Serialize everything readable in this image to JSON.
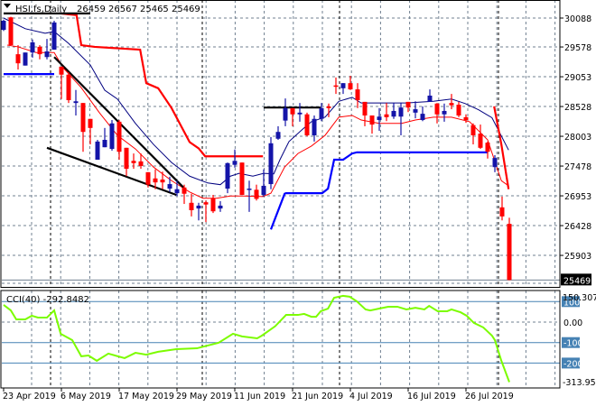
{
  "chart_data": {
    "type": "candlestick",
    "header": {
      "symbol": "HSI.fs,Daily",
      "ohlc": "26459 26567 25465 25469"
    },
    "colors": {
      "up": "#1414a8",
      "down": "#ff0000",
      "ma_fast": "#ff0000",
      "ma_slow": "#000080",
      "envelope_upper": "#ff0000",
      "envelope_lower": "#0000ff",
      "trendline": "#000000",
      "cci": "#7cfc00",
      "cci_level": "#4682b4",
      "grid": "#708090"
    },
    "price_axis": {
      "min": 25375,
      "max": 30168,
      "ticks": [
        "30088",
        "29578",
        "29053",
        "28528",
        "28003",
        "27478",
        "26953",
        "26428",
        "25903"
      ],
      "tick_values": [
        30088,
        29578,
        29053,
        28528,
        28003,
        27478,
        26953,
        26428,
        25903
      ],
      "last_price": "25469"
    },
    "date_labels": [
      {
        "bar": 0,
        "label": "23 Apr 2019"
      },
      {
        "bar": 8,
        "label": "6 May 2019"
      },
      {
        "bar": 16,
        "label": "17 May 2019"
      },
      {
        "bar": 24,
        "label": "29 May 2019"
      },
      {
        "bar": 32,
        "label": "11 Jun 2019"
      },
      {
        "bar": 40,
        "label": "21 Jun 2019"
      },
      {
        "bar": 48,
        "label": "4 Jul 2019"
      },
      {
        "bar": 56,
        "label": "16 Jul 2019"
      },
      {
        "bar": 64,
        "label": "26 Jul 2019"
      }
    ],
    "period_separators": [
      6,
      27,
      46,
      68
    ],
    "candles_ohlc": [
      [
        29880,
        30060,
        29860,
        30040
      ],
      [
        30100,
        30110,
        29610,
        29610
      ],
      [
        29450,
        29610,
        29180,
        29290
      ],
      [
        29250,
        29480,
        29250,
        29480
      ],
      [
        29480,
        29710,
        29390,
        29660
      ],
      [
        29580,
        29610,
        29360,
        29450
      ],
      [
        29400,
        29720,
        29360,
        29500
      ],
      [
        29530,
        30040,
        29530,
        30010
      ],
      [
        29230,
        29230,
        28660,
        29090
      ],
      [
        29090,
        29130,
        28590,
        28640
      ],
      [
        28590,
        28820,
        28370,
        28620
      ],
      [
        28590,
        28590,
        27730,
        28080
      ],
      [
        28310,
        28310,
        27860,
        28150
      ],
      [
        27590,
        27940,
        27590,
        27910
      ],
      [
        27810,
        28150,
        27810,
        27940
      ],
      [
        27780,
        28290,
        27750,
        28230
      ],
      [
        28260,
        28290,
        27590,
        27730
      ],
      [
        27800,
        27800,
        27300,
        27430
      ],
      [
        27570,
        27700,
        27430,
        27530
      ],
      [
        27560,
        27700,
        27430,
        27480
      ],
      [
        27370,
        27370,
        27100,
        27150
      ],
      [
        27260,
        27420,
        27070,
        27190
      ],
      [
        27240,
        27380,
        27070,
        27190
      ],
      [
        27080,
        27290,
        27020,
        27160
      ],
      [
        27000,
        27220,
        26950,
        27070
      ],
      [
        27100,
        27150,
        26810,
        26990
      ],
      [
        26830,
        26990,
        26590,
        26700
      ],
      [
        26730,
        26830,
        26520,
        26780
      ],
      [
        26840,
        26870,
        26490,
        26800
      ],
      [
        26910,
        26970,
        26650,
        26680
      ],
      [
        26730,
        26860,
        26670,
        26780
      ],
      [
        27080,
        27540,
        27000,
        27530
      ],
      [
        27500,
        27770,
        27450,
        27570
      ],
      [
        27540,
        27540,
        26970,
        26970
      ],
      [
        27070,
        27220,
        26670,
        27080
      ],
      [
        27060,
        27150,
        26870,
        26900
      ],
      [
        26970,
        27420,
        26940,
        27130
      ],
      [
        27160,
        27990,
        27070,
        27880
      ],
      [
        27960,
        28180,
        27940,
        28080
      ],
      [
        28280,
        28670,
        28180,
        28500
      ],
      [
        28500,
        28500,
        28180,
        28390
      ],
      [
        28390,
        28590,
        28260,
        28420
      ],
      [
        28390,
        28420,
        28000,
        28020
      ],
      [
        28020,
        28370,
        27910,
        28310
      ],
      [
        28310,
        28590,
        28270,
        28500
      ],
      [
        28530,
        28580,
        28340,
        28500
      ],
      [
        28900,
        29040,
        28750,
        28880
      ],
      [
        28850,
        28940,
        28750,
        28940
      ],
      [
        28940,
        29070,
        28820,
        28830
      ],
      [
        28830,
        28940,
        28500,
        28640
      ],
      [
        28610,
        28610,
        28180,
        28370
      ],
      [
        28370,
        28370,
        28050,
        28210
      ],
      [
        28290,
        28500,
        28100,
        28350
      ],
      [
        28390,
        28590,
        28270,
        28340
      ],
      [
        28350,
        28590,
        28310,
        28450
      ],
      [
        28350,
        28590,
        28020,
        28510
      ],
      [
        28610,
        28610,
        28430,
        28510
      ],
      [
        28420,
        28620,
        28320,
        28480
      ],
      [
        28290,
        28530,
        28270,
        28400
      ],
      [
        28610,
        28830,
        28610,
        28720
      ],
      [
        28580,
        28590,
        28230,
        28390
      ],
      [
        28390,
        28580,
        28260,
        28450
      ],
      [
        28590,
        28750,
        28480,
        28550
      ],
      [
        28560,
        28610,
        28340,
        28370
      ],
      [
        28340,
        28390,
        28240,
        28290
      ],
      [
        28200,
        28230,
        27860,
        28020
      ],
      [
        28050,
        28210,
        27780,
        27800
      ],
      [
        27890,
        27910,
        27610,
        27730
      ],
      [
        27460,
        27670,
        27370,
        27620
      ],
      [
        26750,
        26940,
        26520,
        26590
      ],
      [
        26459,
        26567,
        25465,
        25469
      ]
    ],
    "lines": [
      {
        "name": "ma-slow-line",
        "color_key": "ma_slow",
        "width": 1,
        "points": [
          [
            0,
            30088
          ],
          [
            3,
            29900
          ],
          [
            5.75,
            29820
          ],
          [
            7,
            29850
          ],
          [
            9,
            29640
          ],
          [
            12,
            29260
          ],
          [
            14,
            28815
          ],
          [
            15.75,
            28660
          ],
          [
            18.25,
            28230
          ],
          [
            20.75,
            27860
          ],
          [
            23.25,
            27540
          ],
          [
            25.75,
            27300
          ],
          [
            28.25,
            27180
          ],
          [
            30,
            27150
          ],
          [
            31.4,
            27300
          ],
          [
            32.6,
            27350
          ],
          [
            34.5,
            27300
          ],
          [
            36,
            27350
          ],
          [
            37.4,
            27340
          ],
          [
            38.25,
            27590
          ],
          [
            39.5,
            27910
          ],
          [
            41.4,
            28130
          ],
          [
            42.6,
            28260
          ],
          [
            44.5,
            28340
          ],
          [
            46.4,
            28620
          ],
          [
            48.25,
            28690
          ],
          [
            49.5,
            28590
          ],
          [
            52,
            28590
          ],
          [
            55.75,
            28590
          ],
          [
            59.5,
            28620
          ],
          [
            62,
            28660
          ],
          [
            63.9,
            28580
          ],
          [
            65.75,
            28470
          ],
          [
            67.6,
            28330
          ],
          [
            69.9,
            27760
          ]
        ]
      },
      {
        "name": "ma-fast-line",
        "color_key": "ma_fast",
        "width": 1,
        "points": [
          [
            0.5,
            29610
          ],
          [
            2,
            29580
          ],
          [
            4.5,
            29480
          ],
          [
            7,
            29480
          ],
          [
            8.25,
            29210
          ],
          [
            10.75,
            28860
          ],
          [
            13.25,
            28420
          ],
          [
            15.75,
            28020
          ],
          [
            18.25,
            27780
          ],
          [
            20.75,
            27460
          ],
          [
            23.25,
            27220
          ],
          [
            25.75,
            27020
          ],
          [
            27.6,
            26910
          ],
          [
            29.5,
            26910
          ],
          [
            31.4,
            26950
          ],
          [
            33.25,
            26950
          ],
          [
            35.9,
            26940
          ],
          [
            37,
            27000
          ],
          [
            38.9,
            27460
          ],
          [
            40.75,
            27700
          ],
          [
            42.6,
            27830
          ],
          [
            44.5,
            28020
          ],
          [
            46.4,
            28340
          ],
          [
            48.25,
            28370
          ],
          [
            49.5,
            28290
          ],
          [
            52,
            28230
          ],
          [
            55.1,
            28230
          ],
          [
            57,
            28290
          ],
          [
            59.5,
            28340
          ],
          [
            62,
            28340
          ],
          [
            64.5,
            28260
          ],
          [
            67,
            27940
          ],
          [
            68.9,
            27220
          ],
          [
            69.9,
            27130
          ]
        ]
      },
      {
        "name": "upper-band-line",
        "color_key": "envelope_upper",
        "width": 2.2,
        "points": [
          [
            7.9,
            30170
          ],
          [
            10.1,
            30140
          ],
          [
            10.75,
            29610
          ],
          [
            12.6,
            29580
          ],
          [
            16.4,
            29550
          ],
          [
            18.9,
            29530
          ],
          [
            19.75,
            28940
          ],
          [
            21.4,
            28850
          ],
          [
            23.25,
            28500
          ],
          [
            25.75,
            27900
          ],
          [
            27,
            27790
          ],
          [
            27.9,
            27650
          ],
          [
            35.9,
            27650
          ]
        ]
      },
      {
        "name": "upper-band-line-2",
        "color_key": "envelope_upper",
        "width": 2.2,
        "points": [
          [
            67.9,
            28530
          ],
          [
            68.9,
            27860
          ],
          [
            69.9,
            27070
          ]
        ]
      },
      {
        "name": "lower-band-line",
        "color_key": "envelope_lower",
        "width": 2.2,
        "points": [
          [
            0,
            29100
          ],
          [
            7,
            29100
          ]
        ]
      },
      {
        "name": "lower-band-line-2",
        "color_key": "envelope_lower",
        "width": 2.2,
        "points": [
          [
            37,
            26360
          ],
          [
            38.9,
            26990
          ],
          [
            39.1,
            27000
          ],
          [
            44.1,
            27000
          ],
          [
            44.9,
            27080
          ],
          [
            45.75,
            27590
          ],
          [
            47,
            27590
          ],
          [
            48.25,
            27700
          ],
          [
            48.9,
            27720
          ],
          [
            67,
            27720
          ]
        ]
      },
      {
        "name": "trendline-top-horizontal",
        "color_key": "trendline",
        "width": 2.2,
        "points": [
          [
            0,
            30170
          ],
          [
            12,
            30170
          ]
        ]
      },
      {
        "name": "trendline-upper-diagonal",
        "color_key": "trendline",
        "width": 2.2,
        "points": [
          [
            7,
            29400
          ],
          [
            24.9,
            27100
          ]
        ]
      },
      {
        "name": "trendline-lower-diagonal",
        "color_key": "trendline",
        "width": 2.2,
        "points": [
          [
            6,
            27800
          ],
          [
            23.9,
            26970
          ]
        ]
      },
      {
        "name": "trendline-resistance",
        "color_key": "trendline",
        "width": 2.2,
        "points": [
          [
            36,
            28510
          ],
          [
            43.9,
            28510
          ]
        ]
      }
    ],
    "cci": {
      "label": "CCI(40) -292.8482",
      "range": [
        -313.9504,
        150.3071
      ],
      "axis_labels": {
        "max": "150.3071",
        "min": "-313.950"
      },
      "levels": [
        {
          "value": 100,
          "label": "100"
        },
        {
          "value": 0,
          "label": "0.00"
        },
        {
          "value": -100,
          "label": "-100"
        },
        {
          "value": -200,
          "label": "-200"
        }
      ],
      "points": [
        [
          0,
          84
        ],
        [
          1,
          57
        ],
        [
          1.75,
          13
        ],
        [
          3,
          13
        ],
        [
          3.9,
          31
        ],
        [
          4.75,
          22
        ],
        [
          6,
          22
        ],
        [
          7,
          57
        ],
        [
          7.9,
          -57
        ],
        [
          9.5,
          -88
        ],
        [
          10.75,
          -167
        ],
        [
          11.75,
          -163
        ],
        [
          12.9,
          -189
        ],
        [
          14.5,
          -154
        ],
        [
          16.75,
          -176
        ],
        [
          18.25,
          -150
        ],
        [
          19.75,
          -159
        ],
        [
          21.4,
          -145
        ],
        [
          23.9,
          -132
        ],
        [
          26.75,
          -128
        ],
        [
          29.75,
          -101
        ],
        [
          31.75,
          -57
        ],
        [
          33,
          -70
        ],
        [
          35.1,
          -79
        ],
        [
          35.75,
          -66
        ],
        [
          37.6,
          -20
        ],
        [
          39.1,
          35
        ],
        [
          40.75,
          35
        ],
        [
          41.6,
          40
        ],
        [
          42.6,
          26
        ],
        [
          43.25,
          26
        ],
        [
          43.9,
          53
        ],
        [
          44.9,
          66
        ],
        [
          45.75,
          119
        ],
        [
          47,
          128
        ],
        [
          47.9,
          124
        ],
        [
          48.9,
          101
        ],
        [
          50.1,
          62
        ],
        [
          50.75,
          57
        ],
        [
          52,
          66
        ],
        [
          53.25,
          75
        ],
        [
          54.5,
          75
        ],
        [
          55.75,
          62
        ],
        [
          57,
          70
        ],
        [
          58.25,
          62
        ],
        [
          58.9,
          79
        ],
        [
          60.1,
          53
        ],
        [
          61.4,
          53
        ],
        [
          62,
          62
        ],
        [
          63.25,
          48
        ],
        [
          64.1,
          31
        ],
        [
          65.1,
          -4
        ],
        [
          66.4,
          -26
        ],
        [
          67.6,
          -66
        ],
        [
          68,
          -88
        ],
        [
          68.9,
          -189
        ],
        [
          70,
          -292.85
        ]
      ]
    }
  }
}
